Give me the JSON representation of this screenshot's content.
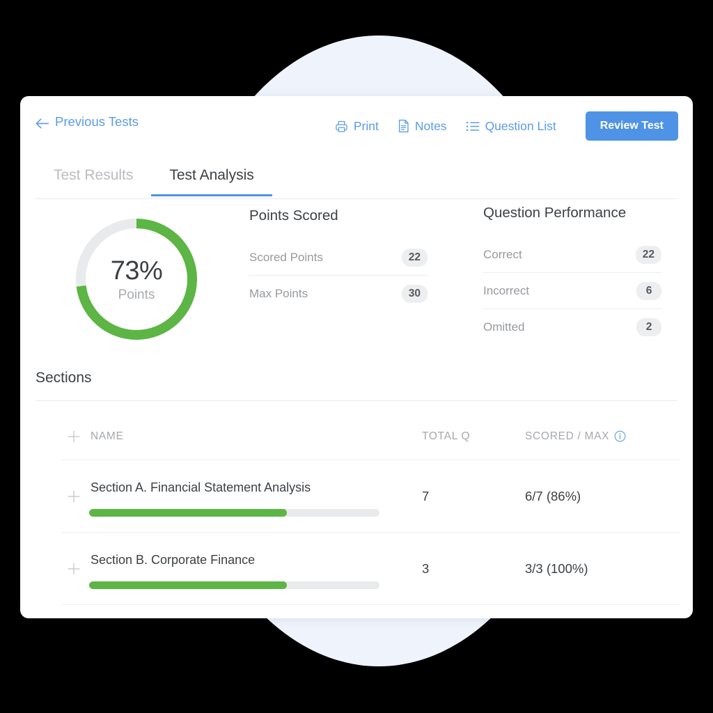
{
  "theme": {
    "accent_blue": "#4f93e6",
    "link_blue": "#5b9bea",
    "green": "#5cb544",
    "track_gray": "#e8eaeb",
    "bg_circle": "#eff4fc",
    "card_bg": "#ffffff",
    "text_dark": "#3c4044",
    "text_muted": "#96999d"
  },
  "toolbar": {
    "back_label": "Previous Tests",
    "back_icon": "arrow-left-icon",
    "actions": [
      {
        "label": "Print",
        "icon": "printer-icon"
      },
      {
        "label": "Notes",
        "icon": "document-icon"
      },
      {
        "label": "Question List",
        "icon": "list-icon"
      }
    ],
    "review_label": "Review Test"
  },
  "tabs": [
    {
      "label": "Test Results",
      "active": false
    },
    {
      "label": "Test Analysis",
      "active": true
    }
  ],
  "score_donut": {
    "percent_text": "73%",
    "caption": "Points",
    "percent_value": 73,
    "fill_color": "#5cb544",
    "track_color": "#e8eaeb"
  },
  "points_scored": {
    "title": "Points Scored",
    "rows": [
      {
        "label": "Scored Points",
        "value": "22"
      },
      {
        "label": "Max Points",
        "value": "30"
      }
    ]
  },
  "question_performance": {
    "title": "Question Performance",
    "rows": [
      {
        "label": "Correct",
        "value": "22"
      },
      {
        "label": "Incorrect",
        "value": "6"
      },
      {
        "label": "Omitted",
        "value": "2"
      }
    ]
  },
  "sections": {
    "heading": "Sections",
    "columns": {
      "expand_icon": "plus-icon",
      "name": "NAME",
      "total_q": "TOTAL Q",
      "scored_max": "SCORED / MAX",
      "info_icon": "info-icon"
    },
    "rows": [
      {
        "expand_icon": "plus-icon",
        "name": "Section A. Financial Statement Analysis",
        "total_q": "7",
        "scored_max": "6/7 (86%)",
        "bar_percent": 68
      },
      {
        "expand_icon": "plus-icon",
        "name": "Section B. Corporate Finance",
        "total_q": "3",
        "scored_max": "3/3 (100%)",
        "bar_percent": 68
      }
    ]
  }
}
